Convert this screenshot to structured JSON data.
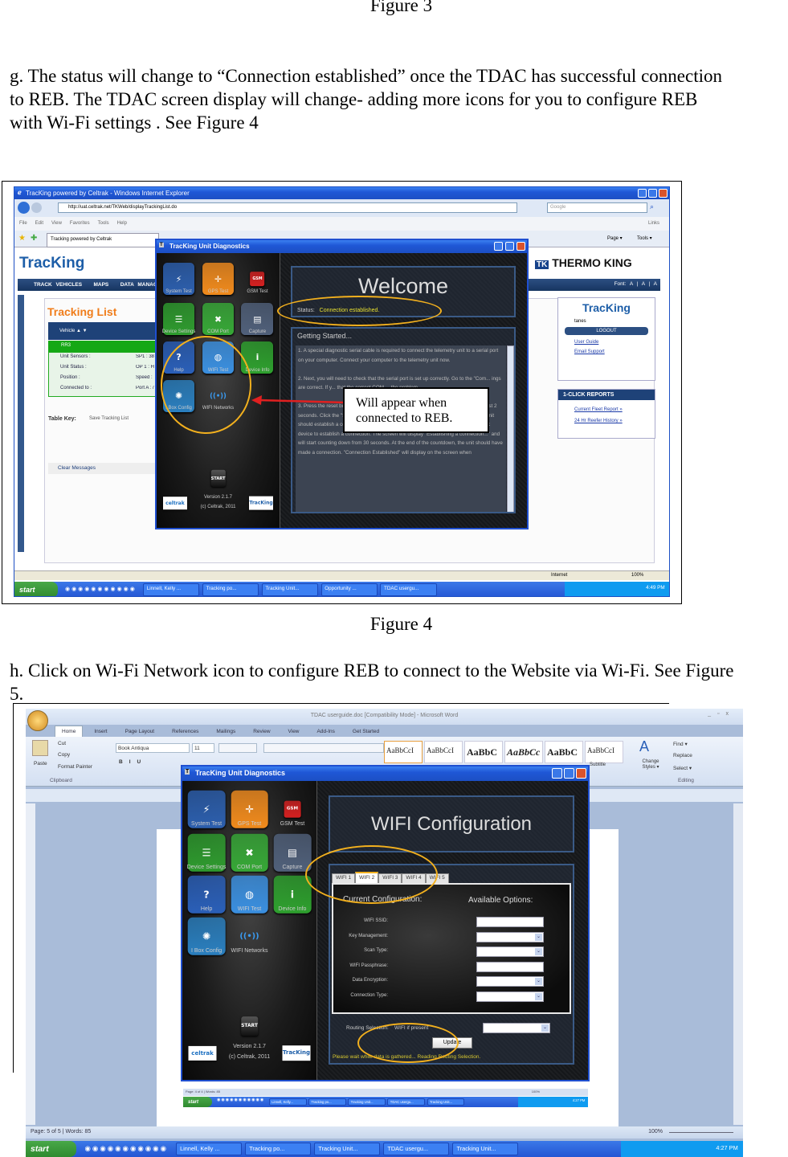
{
  "doc": {
    "figure3_caption": "Figure 3",
    "para_g_lines": [
      "g. The status will change to “Connection established” once the TDAC has successful connection",
      "to REB. The  TDAC screen  display will change- adding more icons for you to configure REB",
      "with Wi-Fi  settings . See Figure 4"
    ],
    "figure4_caption": "Figure 4",
    "para_h_lines": [
      "h. Click on Wi-Fi Network icon to configure REB to connect to the Website via Wi-Fi. See Figure",
      "5."
    ]
  },
  "ie": {
    "title": "TracKing powered by Celtrak - Windows Internet Explorer",
    "url": "http://uat.celtrak.net/TKWeb/displayTrackingList.do",
    "search_placeholder": "Google",
    "menu": [
      "File",
      "Edit",
      "View",
      "Favorites",
      "Tools",
      "Help"
    ],
    "links_label": "Links",
    "tab_title": "Tracking powered by Celtrak",
    "toolbar_right": [
      "Page ▾",
      "Tools ▾"
    ],
    "logo": "TracKing",
    "nav": [
      "TRACK VEHICLES",
      "MAPS",
      "DATA MANAG"
    ],
    "brand": "THERMO KING",
    "font_label": "Font: A | A | A",
    "tracking_list_title": "Tracking List",
    "vehicle_header": "Vehicle ▲ ▼",
    "vehicle_row": "RR3",
    "detail_labels": [
      "Unit Sensors :",
      "Unit Status :",
      "Position :",
      "Connected to :"
    ],
    "detail_values": [
      "SP1 : 38",
      "OP 1 : H",
      "Speed :",
      "Port A : / Port B :"
    ],
    "table_key": "Table Key:",
    "save_list": "Save Tracking List",
    "clear_messages": "Clear Messages",
    "side_logo": "TracKing",
    "user": "tanes",
    "logout": "LOGOUT",
    "user_guide": "User Guide",
    "email_support": "Email Support",
    "reports_title": "1-CLICK REPORTS",
    "reports": [
      "Current Fleet Report »",
      "24 Hr Reefer History »"
    ],
    "status_zone": "Internet",
    "zoom": "100%",
    "taskbar": {
      "start": "start",
      "items": [
        "Linnell, Kelly ...",
        "Tracking po...",
        "Tracking Unit...",
        "Opportunity ...",
        "TDAC usergu..."
      ],
      "clock": "4:49 PM"
    }
  },
  "diag": {
    "title": "TracKing Unit Diagnostics",
    "icons": [
      {
        "label": "System Test",
        "name": "system-test-icon",
        "color": "#2c5fae",
        "glyph": "⚡"
      },
      {
        "label": "GPS Test",
        "name": "gps-compass-icon",
        "color": "#f08a1c",
        "glyph": "✛"
      },
      {
        "label": "GSM Test",
        "name": "gsm-phone-icon",
        "color": "#d42020",
        "glyph": "GSM"
      },
      {
        "label": "Device Settings",
        "name": "device-settings-icon",
        "color": "#2e9b2e",
        "glyph": "☰"
      },
      {
        "label": "COM Port",
        "name": "com-port-tools-icon",
        "color": "#36a836",
        "glyph": "✖"
      },
      {
        "label": "Capture",
        "name": "capture-clapper-icon",
        "color": "#50607a",
        "glyph": "▤"
      },
      {
        "label": "Help",
        "name": "help-question-icon",
        "color": "#2a5fb8",
        "glyph": "?"
      },
      {
        "label": "WIFI Test",
        "name": "wifi-test-globe-icon",
        "color": "#3a8fe0",
        "glyph": "◍"
      },
      {
        "label": "Device Info",
        "name": "device-info-icon",
        "color": "#2ea02e",
        "glyph": "i"
      },
      {
        "label": "I Box Config",
        "name": "ibox-config-gear-icon",
        "color": "#2a7fbf",
        "glyph": "✺"
      },
      {
        "label": "WIFI Networks",
        "name": "wifi-networks-icon",
        "color": "",
        "glyph": "((•))"
      }
    ],
    "start": "START",
    "version": "Version 2.1.7",
    "copyright": "(c) Celtrak, 2011",
    "celtrak_logo": "celtrak",
    "tracking_logo": "TracKing"
  },
  "fig4": {
    "welcome": "Welcome",
    "status_label": "Status:",
    "status_value": "Connection established.",
    "status_color": "#e8e030",
    "getting_started": "Getting Started...",
    "steps": [
      "1.  A special diagnostic serial cable is required to connect the telemetry unit to a serial port on your computer.  Connect your computer to the telemetry unit now.",
      "2.  Next, you will need to check that the serial port is set up correctly.  Go to the \"Com... ings are correct.  If y... that the correct COM ... the problem.",
      "3.  Press the reset button on the cable that is connected to the TracKing Unit for at least 2 seconds.  Click the \"Start\" button to start communication with the TracKing Unit.  The unit should establish a connection with the device.  It can take up to 30 seconds for a black device to establish a connection.  The screen will display \"Establishing a connection...\" and will start counting down from 30 seconds.  At the end of the countdown, the unit should have made a connection.  \"Connection Established\" will display on the screen when"
    ],
    "callout": "Will appear when connected to REB.",
    "highlight_color": "#f2b01e",
    "arrow_color": "#e02020"
  },
  "word": {
    "title": "TDAC userguide.doc [Compatibility Mode] - Microsoft Word",
    "tabs": [
      "Home",
      "Insert",
      "Page Layout",
      "References",
      "Mailings",
      "Review",
      "View",
      "Add-Ins",
      "Get Started"
    ],
    "clipboard": {
      "paste": "Paste",
      "cut": "Cut",
      "copy": "Copy",
      "format_painter": "Format Painter",
      "group": "Clipboard"
    },
    "font_name": "Book Antiqua",
    "font_size": "11",
    "styles": [
      "AaBbCcI",
      "AaBbCcI",
      "AaBbC",
      "AaBbCc",
      "AaBbC",
      "AaBbCcI"
    ],
    "style_subtitle": "Subtitle",
    "change_styles": "Change Styles ▾",
    "editing": {
      "find": "Find ▾",
      "replace": "Replace",
      "select": "Select ▾",
      "group": "Editing"
    },
    "status": {
      "page": "Page: 5 of 5",
      "words": "Words: 85",
      "zoom": "100%"
    },
    "inner_status": {
      "page": "Page: 4 of 4",
      "words": "Words: 85",
      "zoom": "100%"
    },
    "taskbar": {
      "start": "start",
      "items": [
        "Linnell, Kelly ...",
        "Tracking po...",
        "Tracking Unit...",
        "TDAC usergu...",
        "Tracking Unit..."
      ],
      "clock": "4:27 PM"
    },
    "inner_taskbar": {
      "start": "start",
      "items": [
        "Linnell, Kelly...",
        "Tracking po...",
        "Tracking Unit...",
        "TDAC usergu...",
        "Tracking Unit..."
      ],
      "clock": "4:27 PM"
    }
  },
  "fig5": {
    "heading": "WIFI Configuration",
    "tabs": [
      "WIFI 1",
      "WIFI 2",
      "WIFI 3",
      "WIFI 4",
      "WIFI 5"
    ],
    "active_tab": "WIFI 2",
    "current_config": "Current Configuration:",
    "available_options": "Available Options:",
    "fields": [
      {
        "label": "WIFI SSID:",
        "type": "text"
      },
      {
        "label": "Key Management:",
        "type": "select"
      },
      {
        "label": "Scan Type:",
        "type": "select"
      },
      {
        "label": "WIFI Passphrase:",
        "type": "text"
      },
      {
        "label": "Data Encryption:",
        "type": "select"
      },
      {
        "label": "Connection Type:",
        "type": "select"
      }
    ],
    "routing_label": "Routing Selection:",
    "routing_value": "WIFI if present",
    "update": "Update",
    "message": "Please wait while data is gathered...  Reading Routing Selection.",
    "message_color": "#d8c830"
  }
}
